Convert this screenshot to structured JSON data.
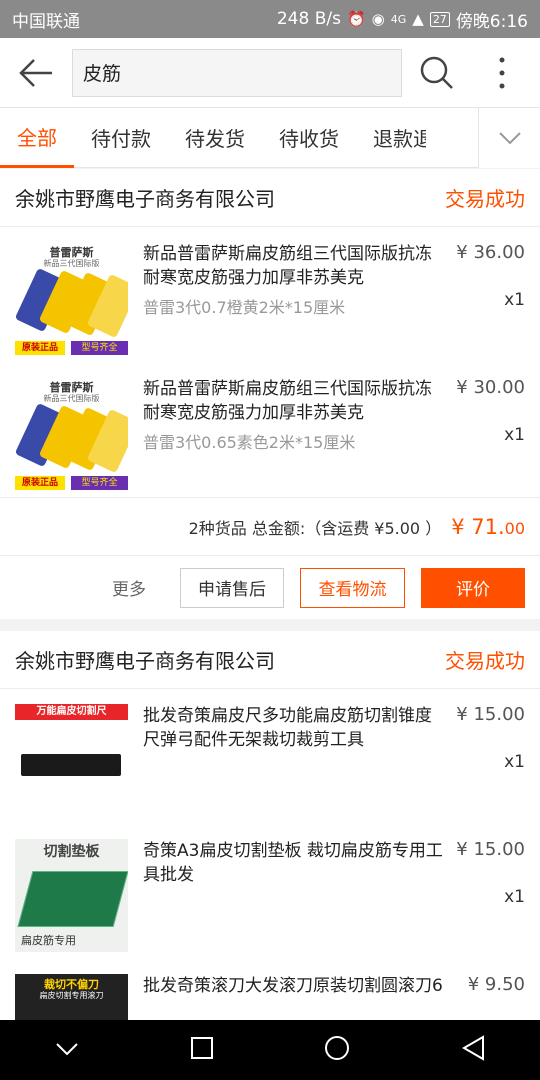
{
  "status_bar": {
    "carrier": "中国联通",
    "speed": "248 B/s",
    "network": "4G",
    "battery": "27",
    "time": "傍晚6:16"
  },
  "search": {
    "query": "皮筋"
  },
  "tabs": [
    "全部",
    "待付款",
    "待发货",
    "待收货",
    "退款退"
  ],
  "orders": [
    {
      "shop": "余姚市野鹰电子商务有限公司",
      "status": "交易成功",
      "items": [
        {
          "title": "新品普雷萨斯扁皮筋组三代国际版抗冻耐寒宽皮筋强力加厚非苏美克",
          "sku": "普雷3代0.7橙黄2米*15厘米",
          "price": "¥ 36.00",
          "qty": "x1",
          "thumb_top": "普雷萨斯",
          "thumb_sub": "新品三代国际版",
          "thumb_b1": "原装正品",
          "thumb_b2": "型号齐全"
        },
        {
          "title": "新品普雷萨斯扁皮筋组三代国际版抗冻耐寒宽皮筋强力加厚非苏美克",
          "sku": "普雷3代0.65素色2米*15厘米",
          "price": "¥ 30.00",
          "qty": "x1",
          "thumb_top": "普雷萨斯",
          "thumb_sub": "新品三代国际版",
          "thumb_b1": "原装正品",
          "thumb_b2": "型号齐全"
        }
      ],
      "summary": {
        "count_label": "2种货品 总金额:（含运费 ¥5.00 ）",
        "total_main": "¥ 71.",
        "total_cents": "00"
      },
      "actions": {
        "more": "更多",
        "after_sale": "申请售后",
        "logistics": "查看物流",
        "review": "评价"
      }
    },
    {
      "shop": "余姚市野鹰电子商务有限公司",
      "status": "交易成功",
      "items": [
        {
          "title": "批发奇策扁皮尺多功能扁皮筋切割锥度尺弹弓配件无架裁切裁剪工具",
          "sku": "",
          "price": "¥ 15.00",
          "qty": "x1",
          "thumb_top": "万能扁皮切割尺"
        },
        {
          "title": "奇策A3扁皮切割垫板 裁切扁皮筋专用工具批发",
          "sku": "",
          "price": "¥ 15.00",
          "qty": "x1",
          "thumb_top": "切割垫板",
          "thumb_b1": "扁皮筋专用"
        },
        {
          "title": "批发奇策滚刀大发滚刀原装切割圆滚刀6",
          "sku": "",
          "price": "¥ 9.50",
          "qty": "",
          "thumb_top": "裁切不偏刀",
          "thumb_sub": "扁皮切割专用滚刀"
        }
      ]
    }
  ],
  "colors": {
    "accent": "#ff5000",
    "status_bar": "#8a8a8a"
  }
}
